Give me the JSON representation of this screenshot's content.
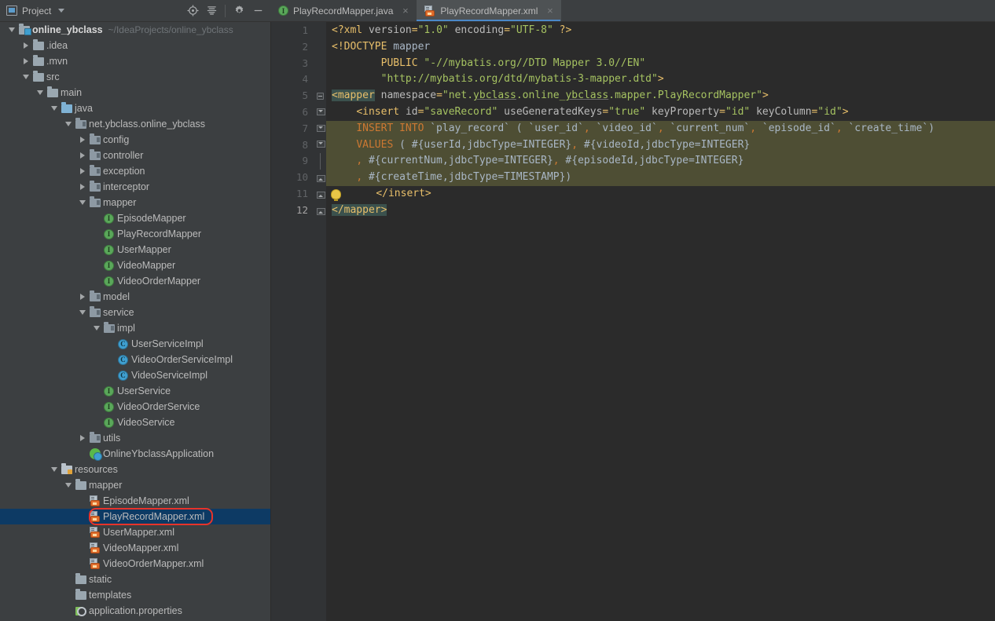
{
  "project_panel": {
    "title": "Project",
    "icons": [
      "project-window-icon",
      "chevron-down-icon",
      "locate-icon",
      "collapse-all-icon",
      "gear-icon",
      "hide-icon"
    ],
    "tree": [
      {
        "label": "online_ybclass",
        "sub": "~/IdeaProjects/online_ybclass",
        "indent": 0,
        "arrow": "open",
        "icon": "project-folder-icon",
        "bold": true
      },
      {
        "label": ".idea",
        "indent": 1,
        "arrow": "closed",
        "icon": "folder-icon"
      },
      {
        "label": ".mvn",
        "indent": 1,
        "arrow": "closed",
        "icon": "folder-icon"
      },
      {
        "label": "src",
        "indent": 1,
        "arrow": "open",
        "icon": "folder-icon"
      },
      {
        "label": "main",
        "indent": 2,
        "arrow": "open",
        "icon": "folder-icon"
      },
      {
        "label": "java",
        "indent": 3,
        "arrow": "open",
        "icon": "source-folder-icon"
      },
      {
        "label": "net.ybclass.online_ybclass",
        "indent": 4,
        "arrow": "open",
        "icon": "package-icon"
      },
      {
        "label": "config",
        "indent": 5,
        "arrow": "closed",
        "icon": "package-icon"
      },
      {
        "label": "controller",
        "indent": 5,
        "arrow": "closed",
        "icon": "package-icon"
      },
      {
        "label": "exception",
        "indent": 5,
        "arrow": "closed",
        "icon": "package-icon"
      },
      {
        "label": "interceptor",
        "indent": 5,
        "arrow": "closed",
        "icon": "package-icon"
      },
      {
        "label": "mapper",
        "indent": 5,
        "arrow": "open",
        "icon": "package-icon"
      },
      {
        "label": "EpisodeMapper",
        "indent": 6,
        "arrow": "none",
        "icon": "interface-icon"
      },
      {
        "label": "PlayRecordMapper",
        "indent": 6,
        "arrow": "none",
        "icon": "interface-icon"
      },
      {
        "label": "UserMapper",
        "indent": 6,
        "arrow": "none",
        "icon": "interface-icon"
      },
      {
        "label": "VideoMapper",
        "indent": 6,
        "arrow": "none",
        "icon": "interface-icon"
      },
      {
        "label": "VideoOrderMapper",
        "indent": 6,
        "arrow": "none",
        "icon": "interface-icon"
      },
      {
        "label": "model",
        "indent": 5,
        "arrow": "closed",
        "icon": "package-icon"
      },
      {
        "label": "service",
        "indent": 5,
        "arrow": "open",
        "icon": "package-icon"
      },
      {
        "label": "impl",
        "indent": 6,
        "arrow": "open",
        "icon": "package-icon"
      },
      {
        "label": "UserServiceImpl",
        "indent": 7,
        "arrow": "none",
        "icon": "class-icon"
      },
      {
        "label": "VideoOrderServiceImpl",
        "indent": 7,
        "arrow": "none",
        "icon": "class-icon"
      },
      {
        "label": "VideoServiceImpl",
        "indent": 7,
        "arrow": "none",
        "icon": "class-icon"
      },
      {
        "label": "UserService",
        "indent": 6,
        "arrow": "none",
        "icon": "interface-icon"
      },
      {
        "label": "VideoOrderService",
        "indent": 6,
        "arrow": "none",
        "icon": "interface-icon"
      },
      {
        "label": "VideoService",
        "indent": 6,
        "arrow": "none",
        "icon": "interface-icon"
      },
      {
        "label": "utils",
        "indent": 5,
        "arrow": "closed",
        "icon": "package-icon"
      },
      {
        "label": "OnlineYbclassApplication",
        "indent": 5,
        "arrow": "none",
        "icon": "spring-boot-icon"
      },
      {
        "label": "resources",
        "indent": 3,
        "arrow": "open",
        "icon": "resources-folder-icon"
      },
      {
        "label": "mapper",
        "indent": 4,
        "arrow": "open",
        "icon": "folder-icon"
      },
      {
        "label": "EpisodeMapper.xml",
        "indent": 5,
        "arrow": "none",
        "icon": "mybatis-mapper-icon"
      },
      {
        "label": "PlayRecordMapper.xml",
        "indent": 5,
        "arrow": "none",
        "icon": "mybatis-mapper-icon",
        "selected": true,
        "annotated": true
      },
      {
        "label": "UserMapper.xml",
        "indent": 5,
        "arrow": "none",
        "icon": "mybatis-mapper-icon"
      },
      {
        "label": "VideoMapper.xml",
        "indent": 5,
        "arrow": "none",
        "icon": "mybatis-mapper-icon"
      },
      {
        "label": "VideoOrderMapper.xml",
        "indent": 5,
        "arrow": "none",
        "icon": "mybatis-mapper-icon"
      },
      {
        "label": "static",
        "indent": 4,
        "arrow": "none",
        "icon": "folder-icon"
      },
      {
        "label": "templates",
        "indent": 4,
        "arrow": "none",
        "icon": "folder-icon"
      },
      {
        "label": "application.properties",
        "indent": 4,
        "arrow": "none",
        "icon": "properties-icon"
      }
    ]
  },
  "editor": {
    "tabs": [
      {
        "label": "PlayRecordMapper.java",
        "icon": "interface-icon",
        "active": false,
        "close": "×"
      },
      {
        "label": "PlayRecordMapper.xml",
        "icon": "mybatis-mapper-icon",
        "active": true,
        "close": "×"
      }
    ],
    "line_numbers": [
      "1",
      "2",
      "3",
      "4",
      "5",
      "6",
      "7",
      "8",
      "9",
      "10",
      "11",
      "12"
    ],
    "current_line": 12,
    "lines": [
      "<?xml version=\"1.0\" encoding=\"UTF-8\" ?>",
      "<!DOCTYPE mapper",
      "        PUBLIC \"-//mybatis.org//DTD Mapper 3.0//EN\"",
      "        \"http://mybatis.org/dtd/mybatis-3-mapper.dtd\">",
      "<mapper namespace=\"net.ybclass.online_ybclass.mapper.PlayRecordMapper\">",
      "    <insert id=\"saveRecord\" useGeneratedKeys=\"true\" keyProperty=\"id\" keyColumn=\"id\">",
      "    INSERT INTO `play_record` ( `user_id`, `video_id`, `current_num`, `episode_id`, `create_time`)",
      "    VALUES ( #{userId,jdbcType=INTEGER}, #{videoId,jdbcType=INTEGER}",
      "    , #{currentNum,jdbcType=INTEGER}, #{episodeId,jdbcType=INTEGER}",
      "    , #{createTime,jdbcType=TIMESTAMP})",
      "    </insert>",
      "</mapper>"
    ],
    "intention_bulb_line": 11
  },
  "colors": {
    "panel_bg": "#3c3f41",
    "editor_bg": "#2b2b2b",
    "gutter_bg": "#313335",
    "selection_blue": "#0d3a64",
    "annotation_red": "#e8332a",
    "sql_block": "#4e4e34",
    "tag": "#e8bf6a",
    "attr_value": "#a5c261",
    "keyword": "#cc7832",
    "text": "#a9b7c6",
    "tab_active": "#4e5254",
    "tab_underline": "#4a88c7"
  }
}
